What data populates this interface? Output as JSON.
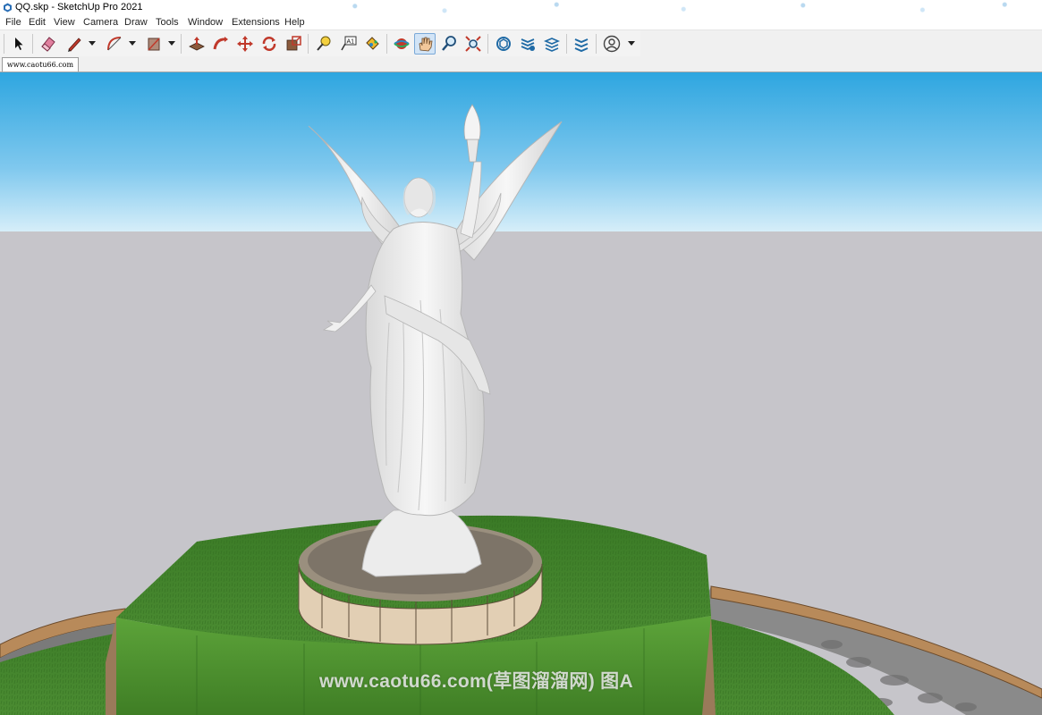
{
  "window": {
    "title": "QQ.skp - SketchUp Pro 2021"
  },
  "menu": [
    "File",
    "Edit",
    "View",
    "Camera",
    "Draw",
    "Tools",
    "Window",
    "Extensions",
    "Help"
  ],
  "toolbar": {
    "tools": [
      {
        "name": "select-tool",
        "icon": "cursor-arrow-icon"
      },
      {
        "name": "eraser-tool",
        "icon": "eraser-icon"
      },
      {
        "name": "line-tool",
        "icon": "pencil-icon"
      },
      {
        "name": "arc-tool",
        "icon": "arc-icon"
      },
      {
        "name": "rectangle-tool",
        "icon": "rectangle-icon"
      },
      {
        "name": "push-pull-tool",
        "icon": "push-pull-icon"
      },
      {
        "name": "follow-me-tool",
        "icon": "follow-me-icon"
      },
      {
        "name": "move-tool",
        "icon": "move-arrows-icon"
      },
      {
        "name": "rotate-tool",
        "icon": "rotate-icon"
      },
      {
        "name": "scale-tool",
        "icon": "scale-icon"
      },
      {
        "name": "tape-measure-tool",
        "icon": "tape-measure-icon"
      },
      {
        "name": "text-tool",
        "icon": "text-a1-icon"
      },
      {
        "name": "paint-bucket-tool",
        "icon": "paint-bucket-icon"
      },
      {
        "name": "orbit-tool",
        "icon": "orbit-icon"
      },
      {
        "name": "pan-tool",
        "icon": "hand-icon",
        "active": true
      },
      {
        "name": "zoom-tool",
        "icon": "magnifier-icon"
      },
      {
        "name": "zoom-extents-tool",
        "icon": "zoom-extents-icon"
      },
      {
        "name": "3d-warehouse",
        "icon": "warehouse-icon"
      },
      {
        "name": "extension-warehouse",
        "icon": "extension-warehouse-icon"
      },
      {
        "name": "layout-send",
        "icon": "layout-icon"
      },
      {
        "name": "extension-manager",
        "icon": "extension-manager-icon"
      },
      {
        "name": "account",
        "icon": "user-circle-icon"
      }
    ]
  },
  "tabs": [
    {
      "label": "www.caotu66.com"
    }
  ],
  "viewport": {
    "watermark": "www.caotu66.com(草图溜溜网) 图A",
    "colors": {
      "sky_top": "#2ea6e0",
      "sky_bottom": "#d6eef9",
      "ground": "#c6c5ca",
      "grass": "#3e7e2a",
      "statue": "#eeeeee",
      "pedestal": "#e2cfb4"
    }
  }
}
